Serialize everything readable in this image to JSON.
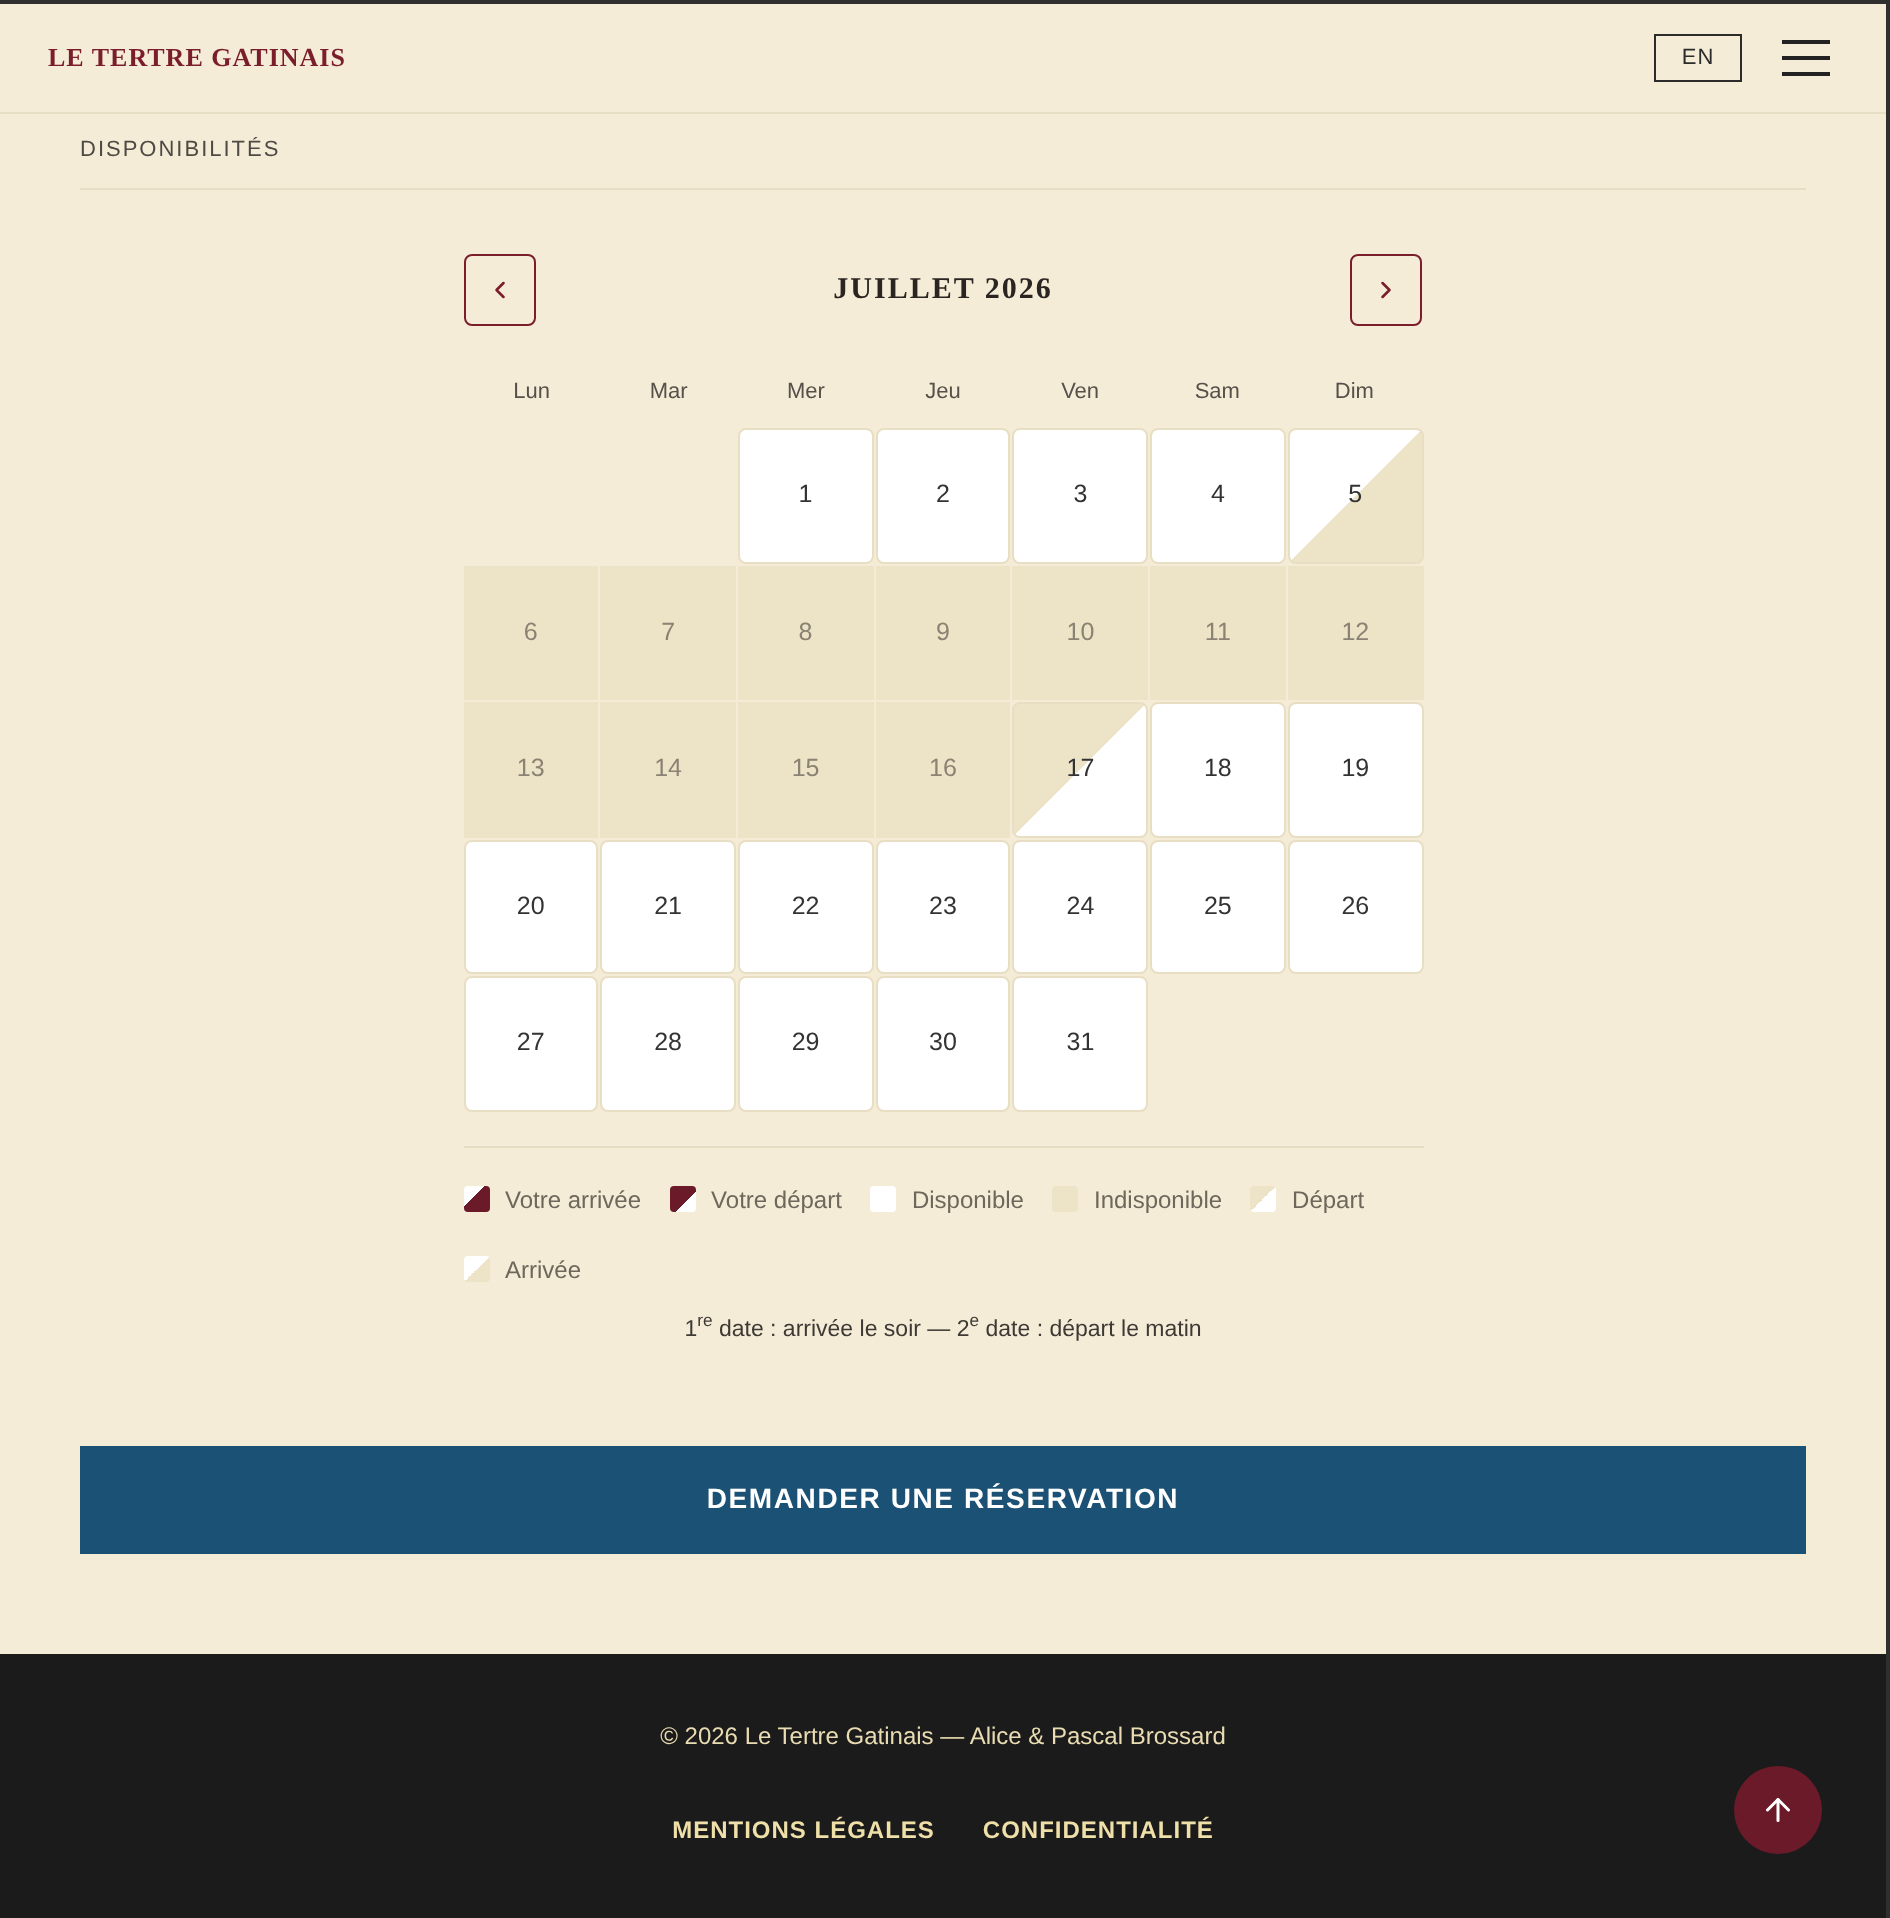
{
  "header": {
    "logo": "LE TERTRE GATINAIS",
    "language_button": "EN"
  },
  "section_title": "DISPONIBILITÉS",
  "calendar": {
    "month": "JUILLET 2026",
    "weekdays": [
      "Lun",
      "Mar",
      "Mer",
      "Jeu",
      "Ven",
      "Sam",
      "Dim"
    ],
    "weeks": [
      [
        {
          "day": "1",
          "kind": "full",
          "available": true
        },
        {
          "day": "2",
          "kind": "full",
          "available": true
        },
        {
          "day": "3",
          "kind": "full",
          "available": true
        },
        {
          "day": "4",
          "kind": "full",
          "available": true
        },
        {
          "day": "5",
          "kind": "arrival",
          "available": true
        }
      ],
      [
        {
          "day": "6",
          "kind": "full",
          "available": false
        },
        {
          "day": "7",
          "kind": "full",
          "available": false
        },
        {
          "day": "8",
          "kind": "full",
          "available": false
        },
        {
          "day": "9",
          "kind": "full",
          "available": false
        },
        {
          "day": "10",
          "kind": "full",
          "available": false
        },
        {
          "day": "11",
          "kind": "full",
          "available": false
        },
        {
          "day": "12",
          "kind": "full",
          "available": false
        }
      ],
      [
        {
          "day": "13",
          "kind": "full",
          "available": false
        },
        {
          "day": "14",
          "kind": "full",
          "available": false
        },
        {
          "day": "15",
          "kind": "full",
          "available": false
        },
        {
          "day": "16",
          "kind": "full",
          "available": false
        },
        {
          "day": "17",
          "kind": "departure",
          "available": true
        },
        {
          "day": "18",
          "kind": "full",
          "available": true
        },
        {
          "day": "19",
          "kind": "full",
          "available": true
        }
      ],
      [
        {
          "day": "20",
          "kind": "full",
          "available": true
        },
        {
          "day": "21",
          "kind": "full",
          "available": true
        },
        {
          "day": "22",
          "kind": "full",
          "available": true
        },
        {
          "day": "23",
          "kind": "full",
          "available": true
        },
        {
          "day": "24",
          "kind": "full",
          "available": true
        },
        {
          "day": "25",
          "kind": "full",
          "available": true
        },
        {
          "day": "26",
          "kind": "full",
          "available": true
        }
      ],
      [
        {
          "day": "27",
          "kind": "full",
          "available": true
        },
        {
          "day": "28",
          "kind": "full",
          "available": true
        },
        {
          "day": "29",
          "kind": "full",
          "available": true
        },
        {
          "day": "30",
          "kind": "full",
          "available": true
        },
        {
          "day": "31",
          "kind": "full",
          "available": true
        }
      ]
    ]
  },
  "legend": [
    {
      "kind": "your-arrival",
      "label": "Votre arrivée"
    },
    {
      "kind": "your-departure",
      "label": "Votre départ"
    },
    {
      "kind": "available",
      "label": "Disponible"
    },
    {
      "kind": "unavailable",
      "label": "Indisponible"
    },
    {
      "kind": "departure",
      "label": "Départ"
    },
    {
      "kind": "arrival",
      "label": "Arrivée"
    }
  ],
  "note": "1$^{re}$ date : arrivée le soir — 2$^{e}$ date : départ le matin",
  "request_button": "DEMANDER UNE RÉSERVATION",
  "footer": {
    "copyright": "© 2026 Le Tertre Gatinais — Alice & Pascal Brossard",
    "links": [
      "MENTIONS LÉGALES",
      "CONFIDENTIALITÉ"
    ]
  }
}
